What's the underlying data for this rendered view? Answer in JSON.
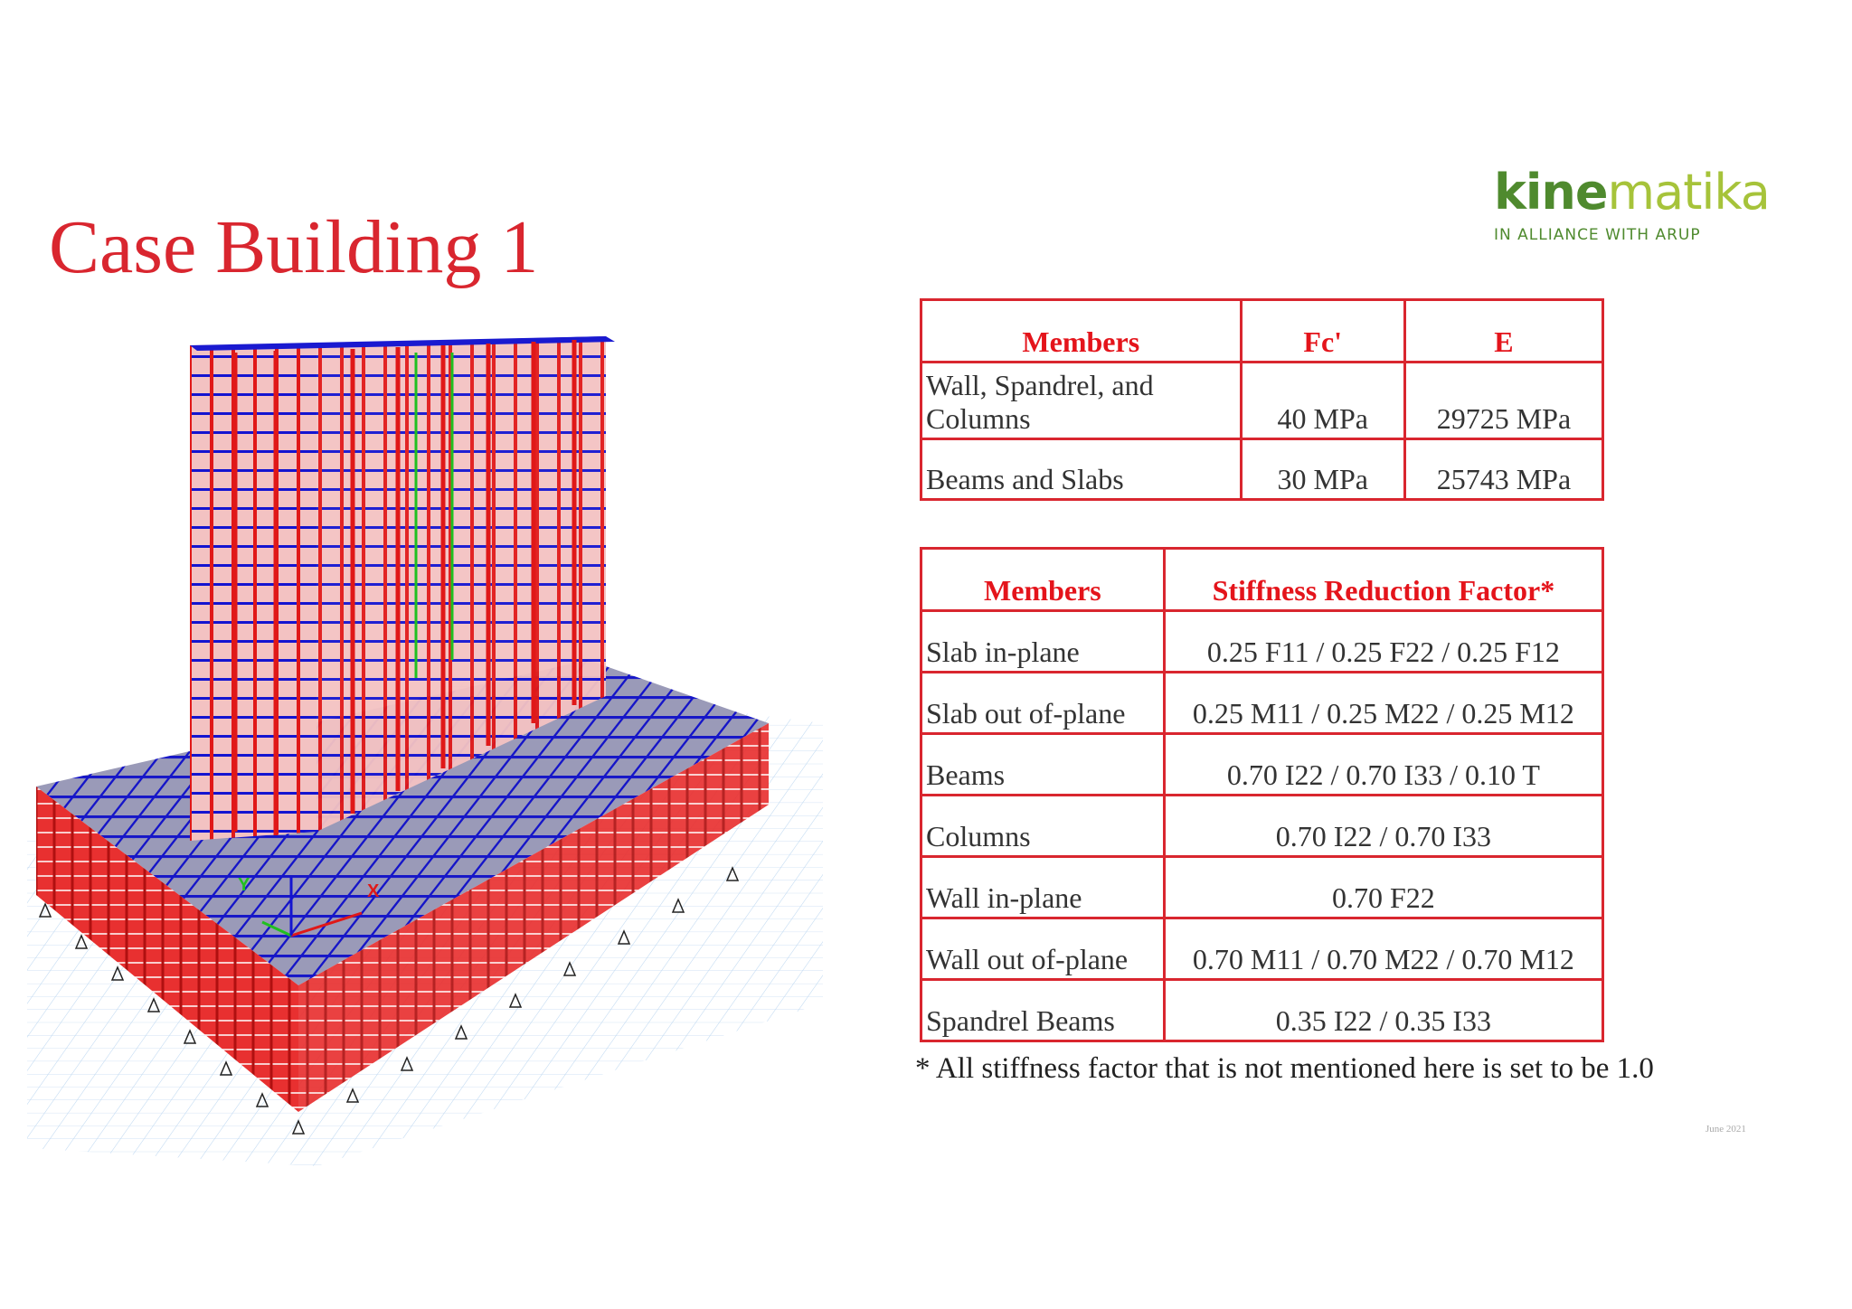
{
  "title": "Case Building 1",
  "logo": {
    "word_bold": "kine",
    "word_light": "matika",
    "tagline": "IN ALLIANCE WITH ARUP"
  },
  "model_image": {
    "description_icon": "structural-3d-model",
    "axis_x": "X",
    "axis_y": "Y"
  },
  "materials_table": {
    "headers": [
      "Members",
      "Fc'",
      "E"
    ],
    "rows": [
      [
        "Wall, Spandrel, and Columns",
        "40 MPa",
        "29725 MPa"
      ],
      [
        "Beams and Slabs",
        "30 MPa",
        "25743 MPa"
      ]
    ]
  },
  "stiffness_table": {
    "headers": [
      "Members",
      "Stiffness Reduction Factor*"
    ],
    "rows": [
      [
        "Slab in-plane",
        "0.25 F11 / 0.25 F22 / 0.25 F12"
      ],
      [
        "Slab out of-plane",
        "0.25 M11 / 0.25 M22 / 0.25 M12"
      ],
      [
        "Beams",
        "0.70 I22 / 0.70 I33 / 0.10 T"
      ],
      [
        "Columns",
        "0.70 I22 / 0.70 I33"
      ],
      [
        "Wall in-plane",
        "0.70 F22"
      ],
      [
        "Wall out of-plane",
        "0.70 M11 / 0.70 M22 / 0.70 M12"
      ],
      [
        "Spandrel Beams",
        "0.35 I22 / 0.35 I33"
      ]
    ]
  },
  "footnote": "* All stiffness factor that is not mentioned here is set to be 1.0",
  "date": "June 2021",
  "colors": {
    "accent_red": "#d9262f",
    "header_red": "#e4141b",
    "frame_blue": "#1f1fd0",
    "logo_green": "#4f8a2e",
    "logo_lime": "#a6c33a"
  }
}
